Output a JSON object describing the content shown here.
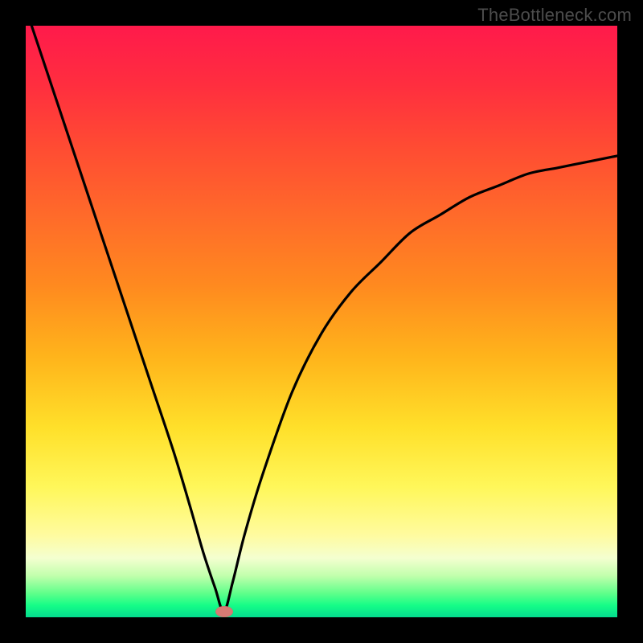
{
  "watermark": {
    "text": "TheBottleneck.com"
  },
  "chart_data": {
    "type": "line",
    "title": "",
    "xlabel": "",
    "ylabel": "",
    "xlim": [
      0,
      100
    ],
    "ylim": [
      0,
      100
    ],
    "grid": false,
    "legend": false,
    "background_gradient": {
      "top_color": "#ff1a4b",
      "bottom_color": "#04dc8e",
      "meaning": "top=high bottleneck, bottom=low bottleneck"
    },
    "optimal_marker": {
      "x": 33.5,
      "y": 1,
      "color": "#d77b74"
    },
    "series": [
      {
        "name": "bottleneck-curve",
        "color": "#000000",
        "x": [
          1,
          5,
          9,
          13,
          17,
          21,
          25,
          28,
          30,
          32,
          33.5,
          35,
          37,
          40,
          45,
          50,
          55,
          60,
          65,
          70,
          75,
          80,
          85,
          90,
          95,
          100
        ],
        "y": [
          100,
          88,
          76,
          64,
          52,
          40,
          28,
          18,
          11,
          5,
          1,
          6,
          14,
          24,
          38,
          48,
          55,
          60,
          65,
          68,
          71,
          73,
          75,
          76,
          77,
          78
        ]
      }
    ]
  }
}
